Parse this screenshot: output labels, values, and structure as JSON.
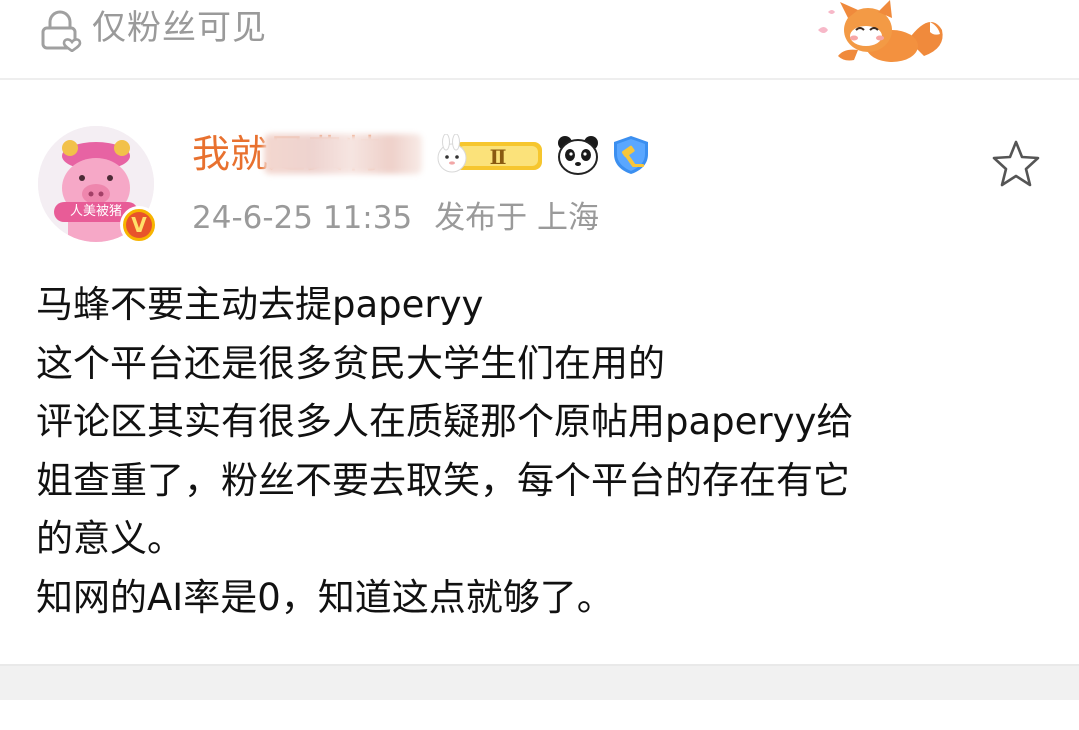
{
  "visibility": {
    "label": "仅粉丝可见",
    "icon": "lock-heart-icon"
  },
  "post": {
    "author": {
      "name": "我就是费特",
      "avatar_tag": "人美被猪",
      "verified_badge": "V"
    },
    "badges": {
      "level": "Ⅱ"
    },
    "time": "24-6-25 11:35",
    "location": "发布于 上海",
    "lines": [
      "马蜂不要主动去提paperyy",
      "这个平台还是很多贫民大学生们在用的",
      "评论区其实有很多人在质疑那个原帖用paperyy给",
      "姐查重了，粉丝不要去取笑，每个平台的存在有它",
      "的意义。",
      "知网的AI率是0，知道这点就够了。"
    ]
  },
  "colors": {
    "accent": "#e8712f",
    "meta": "#9a9a9a",
    "badge_bg": "#f7b400",
    "v_red": "#e8532b"
  }
}
